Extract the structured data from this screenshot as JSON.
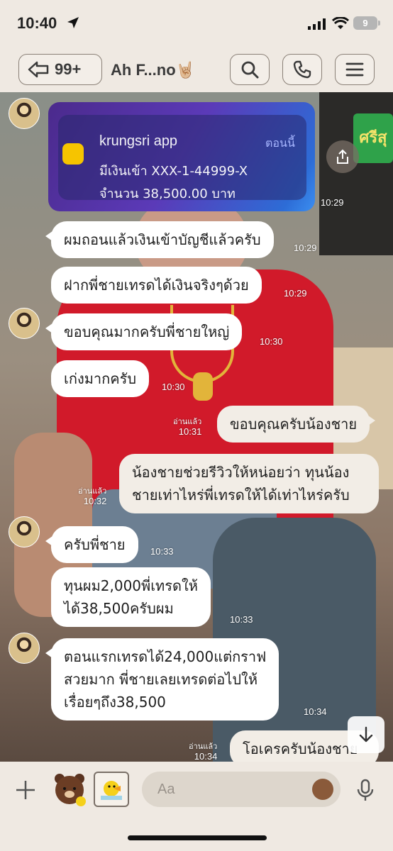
{
  "status_bar": {
    "time": "10:40",
    "battery": "9"
  },
  "header": {
    "back_count": "99+",
    "title": "Ah F...no🤘🏼"
  },
  "notification": {
    "app": "krungsri app",
    "when": "ตอนนี้",
    "line1": "มีเงินเข้า XXX-1-44999-X",
    "line2": "จำนวน 38,500.00 บาท",
    "time": "10:29"
  },
  "background": {
    "shop_sign": "ศรีสุ"
  },
  "messages": [
    {
      "text": "ผมถอนแล้วเงินเข้าบัญชีแล้วครับ",
      "time": "10:29"
    },
    {
      "text": "ฝากพี่ชายเทรดได้เงินจริงๆด้วย",
      "time": "10:29"
    },
    {
      "text": "ขอบคุณมากครับพี่ชายใหญ่",
      "time": "10:30"
    },
    {
      "text": "เก่งมากครับ",
      "time": "10:30"
    },
    {
      "text": "ขอบคุณครับน้องชาย",
      "time": "10:31",
      "read": "อ่านแล้ว"
    },
    {
      "line1": "น้องชายช่วยรีวิวให้หน่อยว่า ทุนน้อง",
      "line2": "ชายเท่าไหร่พี่เทรดให้ได้เท่าไหร่ครับ",
      "time": "10:32",
      "read": "อ่านแล้ว"
    },
    {
      "text": "ครับพี่ชาย",
      "time": "10:33"
    },
    {
      "line1": "ทุนผม2,000พี่เทรดให้",
      "line2": "ได้38,500ครับผม",
      "time": "10:33"
    },
    {
      "line1": "ตอนแรกเทรดได้24,000แต่กราฟ",
      "line2": "สวยมาก พี่ชายเลยเทรดต่อไปให้",
      "line3": "เรื่อยๆถึง38,500",
      "time": "10:34"
    },
    {
      "text": "โอเครครับน้องชาย",
      "time": "10:34",
      "read": "อ่านแล้ว"
    }
  ],
  "input": {
    "placeholder": "Aa"
  },
  "colors": {
    "accent_header": "#efe9e2",
    "bubble_in": "#ffffff",
    "bubble_out": "#f2ede6"
  },
  "icons": [
    "location-arrow-icon",
    "signal-icon",
    "wifi-icon",
    "back-arrow-icon",
    "search-icon",
    "phone-icon",
    "menu-icon",
    "share-icon",
    "scroll-down-icon",
    "plus-icon",
    "sticker-icon",
    "gallery-icon",
    "emoji-icon",
    "mic-icon"
  ]
}
